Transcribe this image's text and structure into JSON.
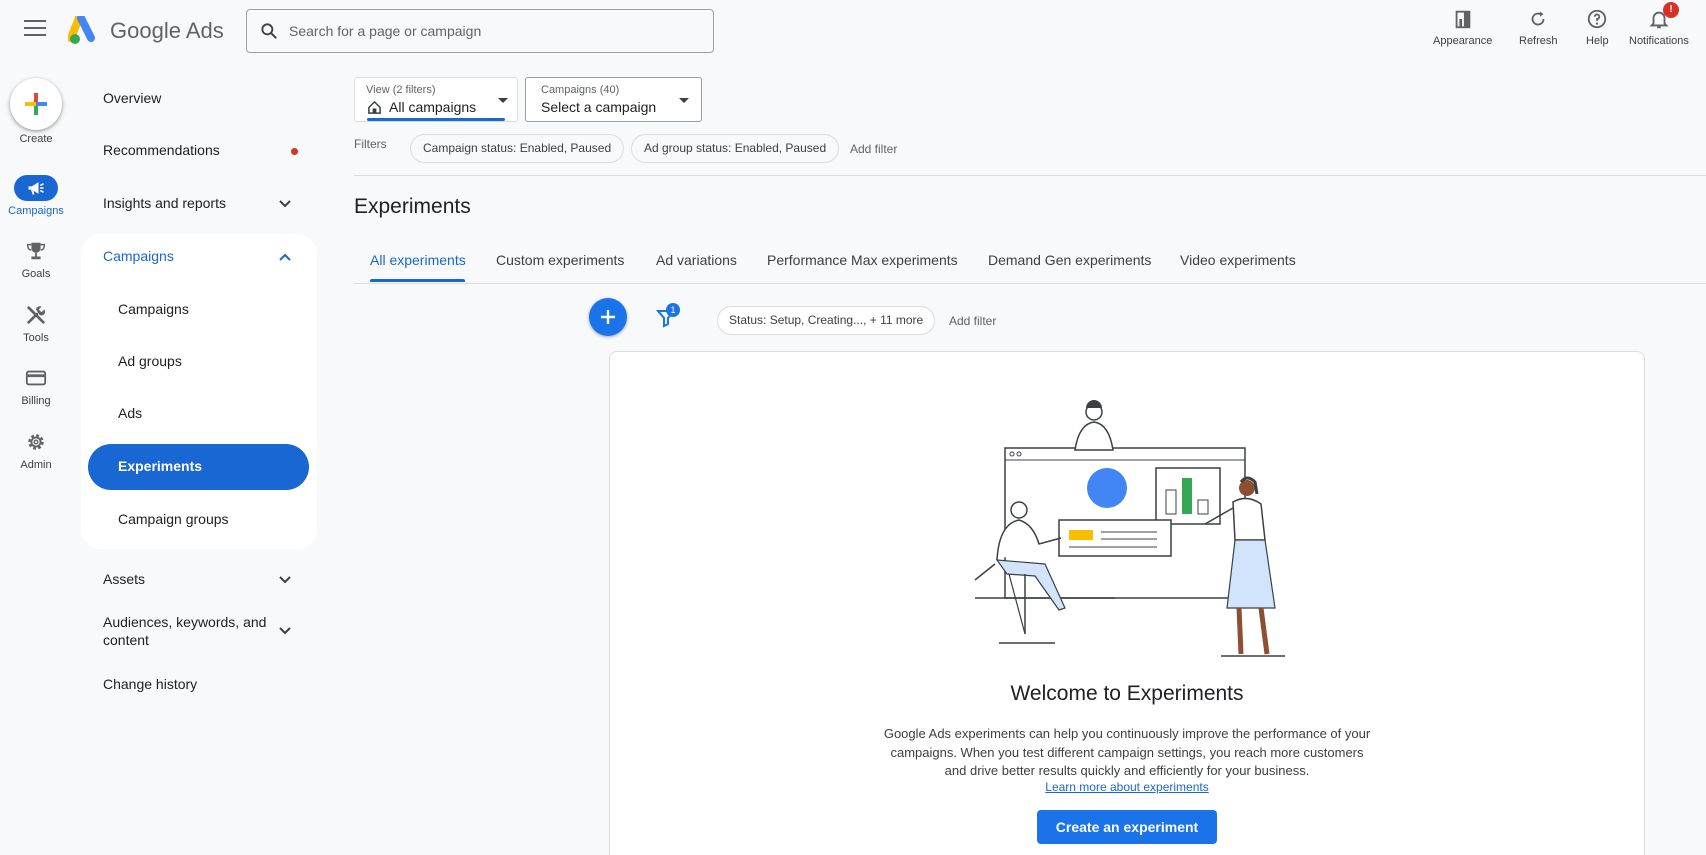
{
  "header": {
    "app_name": "Google Ads",
    "search_placeholder": "Search for a page or campaign",
    "actions": {
      "appearance": "Appearance",
      "refresh": "Refresh",
      "help": "Help",
      "notifications": "Notifications",
      "notifications_badge": "!"
    }
  },
  "rail": {
    "create": "Create",
    "items": [
      {
        "label": "Campaigns",
        "icon": "megaphone-icon"
      },
      {
        "label": "Goals",
        "icon": "trophy-icon"
      },
      {
        "label": "Tools",
        "icon": "tools-icon"
      },
      {
        "label": "Billing",
        "icon": "credit-card-icon"
      },
      {
        "label": "Admin",
        "icon": "gear-icon"
      }
    ]
  },
  "sidebar": {
    "overview": "Overview",
    "recommendations": "Recommendations",
    "insights": "Insights and reports",
    "campaigns_group": "Campaigns",
    "sub_items": [
      "Campaigns",
      "Ad groups",
      "Ads",
      "Experiments",
      "Campaign groups"
    ],
    "assets": "Assets",
    "audiences": "Audiences, keywords, and content",
    "change_history": "Change history"
  },
  "selectors": {
    "view_label": "View (2 filters)",
    "view_value": "All campaigns",
    "campaigns_label": "Campaigns (40)",
    "campaigns_value": "Select a campaign"
  },
  "filters": {
    "label": "Filters",
    "chips": [
      "Campaign status: Enabled, Paused",
      "Ad group status: Enabled, Paused"
    ],
    "add_filter": "Add filter"
  },
  "page": {
    "title": "Experiments",
    "tabs": [
      "All experiments",
      "Custom experiments",
      "Ad variations",
      "Performance Max experiments",
      "Demand Gen experiments",
      "Video experiments"
    ],
    "active_tab": "All experiments"
  },
  "table_toolbar": {
    "filter_count": "1",
    "status_chip": "Status: Setup, Creating..., + 11 more",
    "add_filter": "Add filter"
  },
  "empty_state": {
    "title": "Welcome to Experiments",
    "description": "Google Ads experiments can help you continuously improve the performance of your campaigns. When you test different campaign settings, you reach more customers and drive better results quickly and efficiently for your business.",
    "link": "Learn more about experiments",
    "button": "Create an experiment"
  },
  "colors": {
    "primary": "#1a73e8",
    "nav_active": "#1967d2",
    "alert": "#d93025"
  }
}
